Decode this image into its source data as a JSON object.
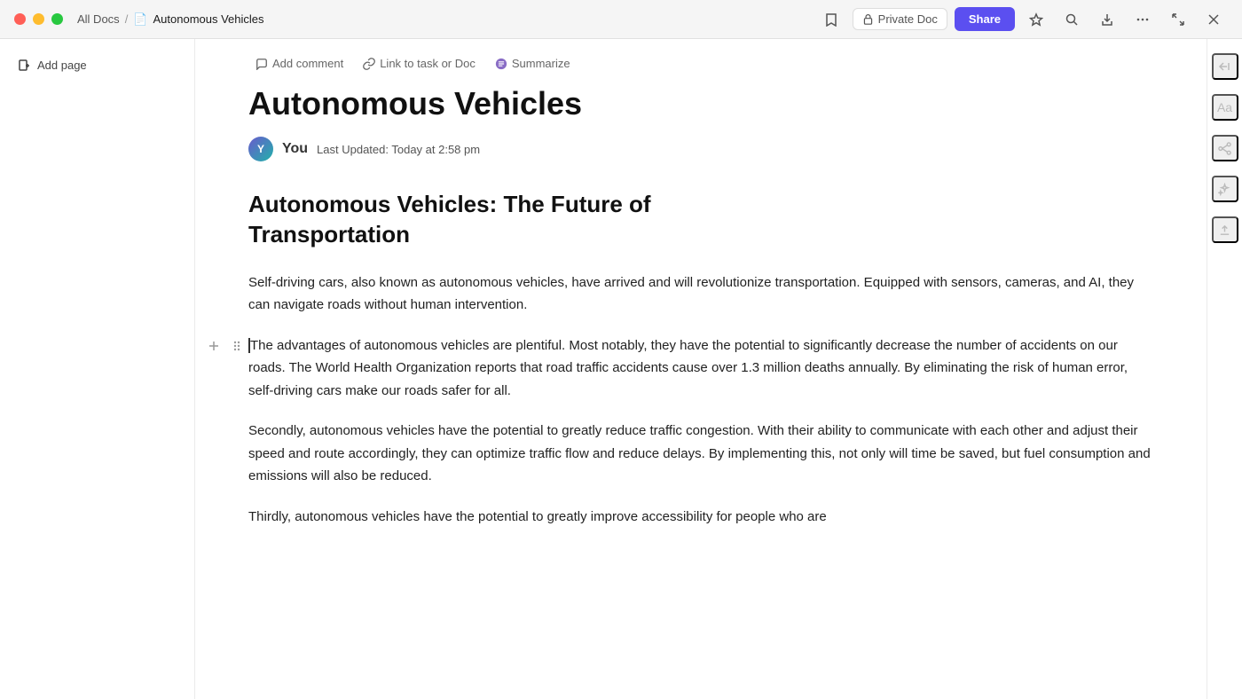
{
  "titlebar": {
    "traffic_lights": [
      "red",
      "yellow",
      "green"
    ],
    "breadcrumb": {
      "all_docs_label": "All Docs",
      "separator": "/",
      "current_doc": "Autonomous Vehicles"
    },
    "private_doc_label": "Private Doc",
    "share_label": "Share"
  },
  "sidebar": {
    "add_page_label": "Add page"
  },
  "doc_toolbar": {
    "add_comment_label": "Add comment",
    "link_task_label": "Link to task or Doc",
    "summarize_label": "Summarize"
  },
  "document": {
    "title": "Autonomous Vehicles",
    "author": "You",
    "last_updated": "Last Updated: Today at 2:58 pm",
    "section_title_line1": "Autonomous Vehicles: The Future of",
    "section_title_line2": "Transportation",
    "paragraph1": "Self-driving cars, also known as autonomous vehicles, have arrived and will revolutionize transportation. Equipped with sensors, cameras, and AI, they can navigate roads without human intervention.",
    "paragraph2": "The advantages of autonomous vehicles are plentiful. Most notably, they have the potential to significantly decrease the number of accidents on our roads. The World Health Organization reports that road traffic accidents cause over 1.3 million deaths annually. By eliminating the risk of human error, self-driving cars make our roads safer for all.",
    "paragraph3": "Secondly, autonomous vehicles have the potential to greatly reduce traffic congestion. With their ability to communicate with each other and adjust their speed and route accordingly, they can optimize traffic flow and reduce delays. By implementing this, not only will time be saved, but fuel consumption and emissions will also be reduced.",
    "paragraph4": "Thirdly, autonomous vehicles have the potential to greatly improve accessibility for people who are"
  },
  "right_sidebar": {
    "icons": [
      "←→",
      "Aa",
      "share",
      "magic",
      "upload"
    ]
  }
}
